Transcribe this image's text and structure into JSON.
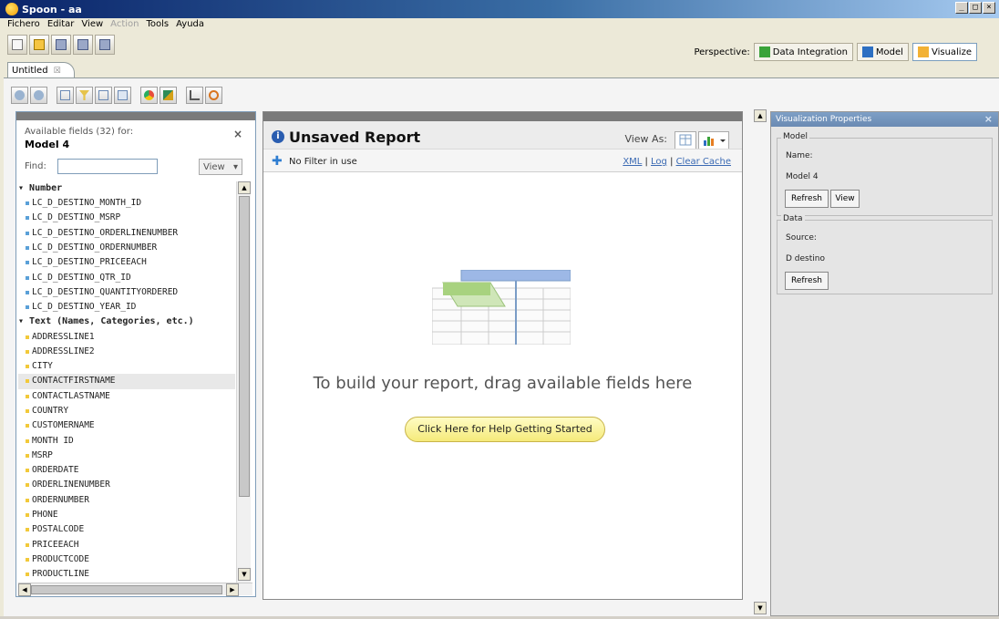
{
  "window": {
    "title": "Spoon - aa",
    "buttons": [
      "_",
      "□",
      "×"
    ]
  },
  "menu": {
    "items": [
      {
        "label": "Fichero",
        "enabled": true
      },
      {
        "label": "Editar",
        "enabled": true
      },
      {
        "label": "View",
        "enabled": true
      },
      {
        "label": "Action",
        "enabled": false
      },
      {
        "label": "Tools",
        "enabled": true
      },
      {
        "label": "Ayuda",
        "enabled": true
      }
    ]
  },
  "perspective": {
    "label": "Perspective:",
    "items": [
      {
        "label": "Data Integration",
        "icon": "data-integration-icon",
        "color": "#3aa33a"
      },
      {
        "label": "Model",
        "icon": "model-icon",
        "color": "#2d6fc2"
      },
      {
        "label": "Visualize",
        "icon": "visualize-icon",
        "color": "#f2b134",
        "active": true
      }
    ]
  },
  "tab": {
    "label": "Untitled",
    "close": "☒"
  },
  "fields_panel": {
    "available_label": "Available fields (32) for:",
    "model_name": "Model 4",
    "close": "×",
    "find_label": "Find:",
    "find_value": "",
    "view_label": "View",
    "groups": [
      {
        "label": "Number",
        "color": "#5aa0d8",
        "fields": [
          "LC_D_DESTINO_MONTH_ID",
          "LC_D_DESTINO_MSRP",
          "LC_D_DESTINO_ORDERLINENUMBER",
          "LC_D_DESTINO_ORDERNUMBER",
          "LC_D_DESTINO_PRICEEACH",
          "LC_D_DESTINO_QTR_ID",
          "LC_D_DESTINO_QUANTITYORDERED",
          "LC_D_DESTINO_YEAR_ID"
        ]
      },
      {
        "label": "Text (Names, Categories, etc.)",
        "color": "#f2c93a",
        "fields": [
          "ADDRESSLINE1",
          "ADDRESSLINE2",
          "CITY",
          "CONTACTFIRSTNAME",
          "CONTACTLASTNAME",
          "COUNTRY",
          "CUSTOMERNAME",
          "MONTH ID",
          "MSRP",
          "ORDERDATE",
          "ORDERLINENUMBER",
          "ORDERNUMBER",
          "PHONE",
          "POSTALCODE",
          "PRICEEACH",
          "PRODUCTCODE",
          "PRODUCTLINE"
        ]
      }
    ],
    "selected_field": "CONTACTFIRSTNAME"
  },
  "report": {
    "title": "Unsaved Report",
    "view_as_label": "View As:",
    "filter_text": "No Filter in use",
    "links": [
      "XML",
      "Log",
      "Clear Cache"
    ],
    "placeholder": "To build your report, drag available fields here",
    "help_button": "Click Here for Help Getting Started"
  },
  "properties": {
    "header": "Visualization Properties",
    "close": "×",
    "model_section": {
      "legend": "Model",
      "name_label": "Name:",
      "name_value": "Model 4",
      "refresh": "Refresh",
      "view": "View"
    },
    "data_section": {
      "legend": "Data",
      "source_label": "Source:",
      "source_value": "D destino",
      "refresh": "Refresh"
    }
  }
}
